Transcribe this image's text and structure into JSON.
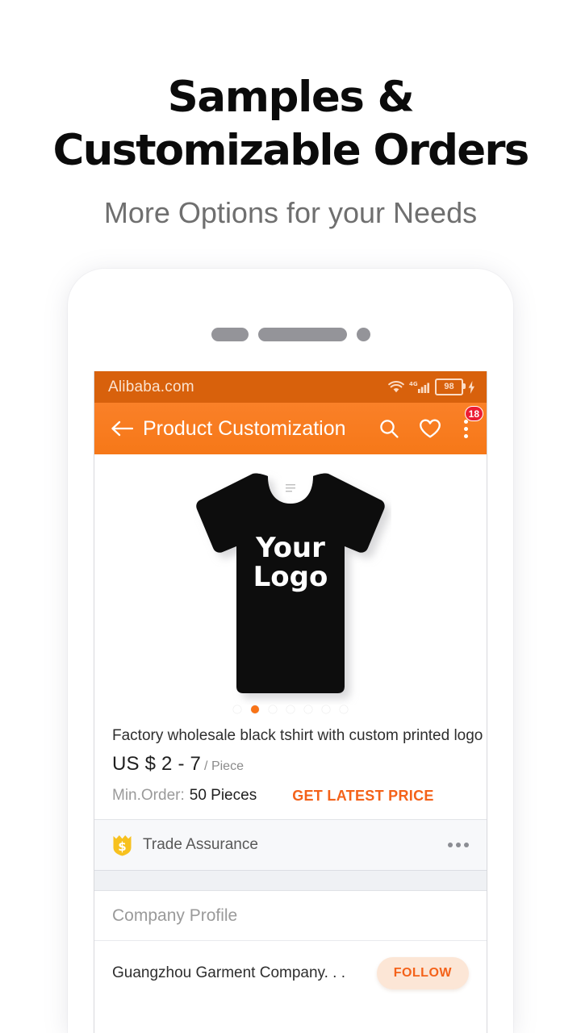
{
  "promo": {
    "headline_line1": "Samples &",
    "headline_line2": "Customizable Orders",
    "subheadline": "More Options for your Needs"
  },
  "phone": {
    "status_bar": {
      "brand": "Alibaba.com",
      "wifi_icon": "wifi-icon",
      "network_type": "4G",
      "signal_icon": "signal-bars-icon",
      "battery_level": "98",
      "charging_icon": "lightning-bolt-icon"
    },
    "app_bar": {
      "back_icon": "back-arrow-icon",
      "title": "Product Customization",
      "search_icon": "search-icon",
      "favorite_icon": "heart-icon",
      "overflow_icon": "overflow-menu-icon",
      "badge_count": "18"
    },
    "gallery": {
      "logo_line1": "Your",
      "logo_line2": "Logo",
      "dot_count": 7,
      "active_dot_index": 1
    },
    "product": {
      "title": "Factory wholesale black tshirt with custom printed logo",
      "price": "US $ 2 - 7",
      "price_unit": "/ Piece",
      "min_order_label": "Min.Order:",
      "min_order_value": "50 Pieces",
      "cta": "GET LATEST PRICE"
    },
    "trade_assurance": {
      "icon": "trade-assurance-shield-icon",
      "label": "Trade Assurance",
      "more_icon": "more-horizontal-icon"
    },
    "company": {
      "section_title": "Company Profile",
      "name": "Guangzhou Garment Company. . .",
      "follow_label": "FOLLOW"
    }
  },
  "colors": {
    "status_bar": "#d8610c",
    "app_bar": "#f87c20",
    "accent_orange": "#f4621a",
    "badge_red": "#ec1d33",
    "trade_gold": "#f7c11f",
    "follow_bg": "#fce6d6"
  }
}
